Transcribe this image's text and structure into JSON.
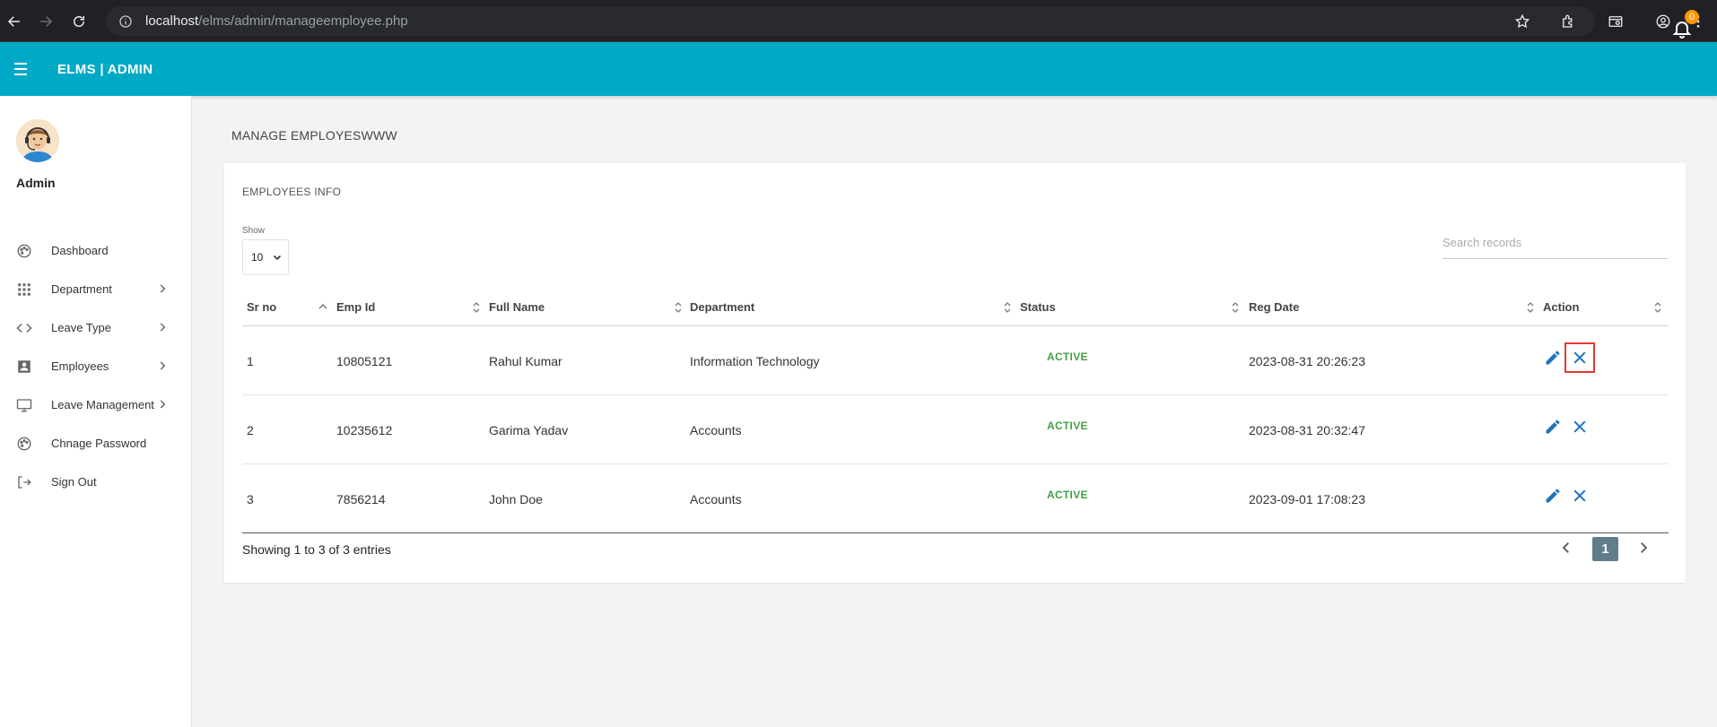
{
  "browser": {
    "url_host": "localhost",
    "url_path": "/elms/admin/manageemployee.php"
  },
  "header": {
    "brand": "ELMS | ADMIN",
    "notification_count": "0"
  },
  "sidebar": {
    "user_name": "Admin",
    "items": [
      {
        "label": "Dashboard",
        "icon": "palette-icon",
        "has_submenu": false
      },
      {
        "label": "Department",
        "icon": "apps-icon",
        "has_submenu": true
      },
      {
        "label": "Leave Type",
        "icon": "code-icon",
        "has_submenu": true
      },
      {
        "label": "Employees",
        "icon": "account-box-icon",
        "has_submenu": true
      },
      {
        "label": "Leave Management",
        "icon": "desktop-icon",
        "has_submenu": true
      },
      {
        "label": "Chnage Password",
        "icon": "palette-icon",
        "has_submenu": false
      },
      {
        "label": "Sign Out",
        "icon": "sign-out-icon",
        "has_submenu": false
      }
    ]
  },
  "page": {
    "title": "MANAGE EMPLOYESWWW"
  },
  "card": {
    "title": "EMPLOYEES INFO",
    "show_label": "Show",
    "show_value": "10",
    "search_placeholder": "Search records"
  },
  "table": {
    "columns": [
      "Sr no",
      "Emp Id",
      "Full Name",
      "Department",
      "Status",
      "Reg Date",
      "Action"
    ],
    "rows": [
      {
        "sr": "1",
        "emp_id": "10805121",
        "name": "Rahul Kumar",
        "department": "Information Technology",
        "status": "ACTIVE",
        "reg_date": "2023-08-31 20:26:23"
      },
      {
        "sr": "2",
        "emp_id": "10235612",
        "name": "Garima Yadav",
        "department": "Accounts",
        "status": "ACTIVE",
        "reg_date": "2023-08-31 20:32:47"
      },
      {
        "sr": "3",
        "emp_id": "7856214",
        "name": "John Doe",
        "department": "Accounts",
        "status": "ACTIVE",
        "reg_date": "2023-09-01 17:08:23"
      }
    ]
  },
  "footer": {
    "info": "Showing 1 to 3 of 3 entries",
    "current_page": "1"
  },
  "colors": {
    "header": "#00a9c5",
    "status_active": "#43a047",
    "action_icon": "#1e73be",
    "highlight": "#e53935",
    "page_button": "#607d8b"
  }
}
